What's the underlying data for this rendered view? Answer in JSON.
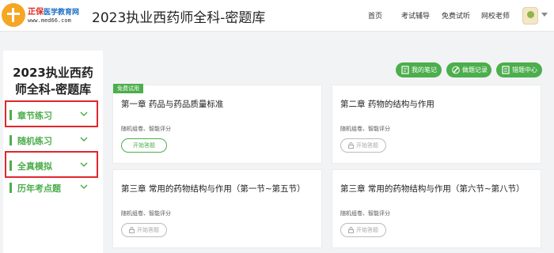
{
  "header": {
    "logo_name_main": "正保",
    "logo_name_rest": "医学教育网",
    "logo_url": "www.med66.com",
    "site_title": "2023执业西药师全科-密题库",
    "nav": [
      "首页",
      "考试辅导",
      "免费试听",
      "网校老师"
    ]
  },
  "sidebar": {
    "title_line1": "2023执业西药",
    "title_line2": "师全科-密题库",
    "items": [
      {
        "label": "章节练习"
      },
      {
        "label": "随机练习"
      },
      {
        "label": "全真模拟"
      },
      {
        "label": "历年考点题"
      }
    ]
  },
  "actions": {
    "notes": "我的笔记",
    "records": "做题记录",
    "wrong": "错题中心"
  },
  "cards": [
    {
      "title": "第一章 药品与药品质量标准",
      "meta": "随机组卷、智能评分",
      "button": "开始答题",
      "tag": "免费试用",
      "locked": false
    },
    {
      "title": "第二章 药物的结构与作用",
      "meta": "随机组卷、智能评分",
      "button": "开始答题",
      "locked": true
    },
    {
      "title": "第三章 常用的药物结构与作用（第一节~第五节）",
      "meta": "随机组卷、智能评分",
      "button": "开始答题",
      "locked": true
    },
    {
      "title": "第三章 常用的药物结构与作用（第六节~第八节）",
      "meta": "随机组卷、智能评分",
      "button": "开始答题",
      "locked": true
    }
  ],
  "colors": {
    "accent": "#4cae4c",
    "highlight": "#e0262c",
    "brand_red": "#e02b20",
    "brand_blue": "#1a6fc4"
  }
}
